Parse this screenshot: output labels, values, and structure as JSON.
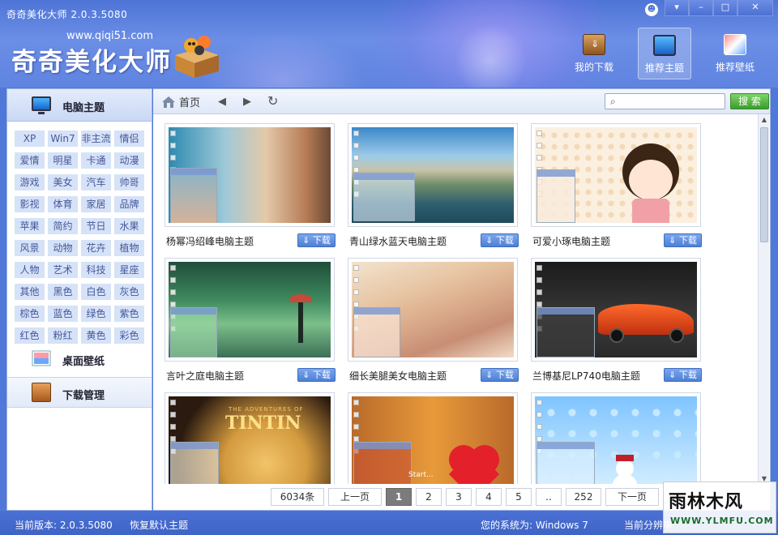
{
  "window": {
    "title": "奇奇美化大师 2.0.3.5080",
    "buttons": [
      "▾",
      "–",
      "□",
      "✕"
    ]
  },
  "logo": {
    "url": "www.qiqi51.com",
    "name": "奇奇美化大师"
  },
  "topnav": [
    {
      "label": "我的下载",
      "icon": "download-box-icon"
    },
    {
      "label": "推荐主题",
      "icon": "monitor-icon",
      "active": true
    },
    {
      "label": "推荐壁纸",
      "icon": "wallpaper-icon"
    }
  ],
  "sidebar": {
    "theme_title": "电脑主题",
    "tags": [
      "XP",
      "Win7",
      "非主流",
      "情侣",
      "爱情",
      "明星",
      "卡通",
      "动漫",
      "游戏",
      "美女",
      "汽车",
      "帅哥",
      "影视",
      "体育",
      "家居",
      "品牌",
      "苹果",
      "简约",
      "节日",
      "水果",
      "风景",
      "动物",
      "花卉",
      "植物",
      "人物",
      "艺术",
      "科技",
      "星座",
      "其他",
      "黑色",
      "白色",
      "灰色",
      "棕色",
      "蓝色",
      "绿色",
      "紫色",
      "红色",
      "粉红",
      "黄色",
      "彩色"
    ],
    "wallpaper_title": "桌面壁纸",
    "download_title": "下载管理"
  },
  "toolbar": {
    "home_label": "首页",
    "search_placeholder": "",
    "search_button": "搜 索"
  },
  "cards": [
    {
      "name": "杨幂冯绍峰电脑主题",
      "download": "下载"
    },
    {
      "name": "青山绿水蓝天电脑主题",
      "download": "下载"
    },
    {
      "name": "可爱小琢电脑主题",
      "download": "下载"
    },
    {
      "name": "言叶之庭电脑主题",
      "download": "下载"
    },
    {
      "name": "细长美腿美女电脑主题",
      "download": "下载"
    },
    {
      "name": "兰博基尼LP740电脑主题",
      "download": "下载"
    },
    {
      "name": "",
      "download": ""
    },
    {
      "name": "",
      "download": ""
    },
    {
      "name": "",
      "download": ""
    }
  ],
  "thumb_text": {
    "tintin_title": "TINTIN",
    "tintin_sub": "THE ADVENTURES OF",
    "start_text": "Start..."
  },
  "pager": {
    "total": "6034条",
    "prev": "上一页",
    "pages": [
      "1",
      "2",
      "3",
      "4",
      "5",
      "..",
      "252"
    ],
    "next": "下一页",
    "current": "1"
  },
  "status": {
    "version": "当前版本: 2.0.3.5080",
    "restore": "恢复默认主题",
    "system": "您的系统为:  Windows 7",
    "resolution": "当前分辨率"
  },
  "watermark": {
    "brand": "雨林木风",
    "site": "WWW.YLMFU.COM"
  }
}
